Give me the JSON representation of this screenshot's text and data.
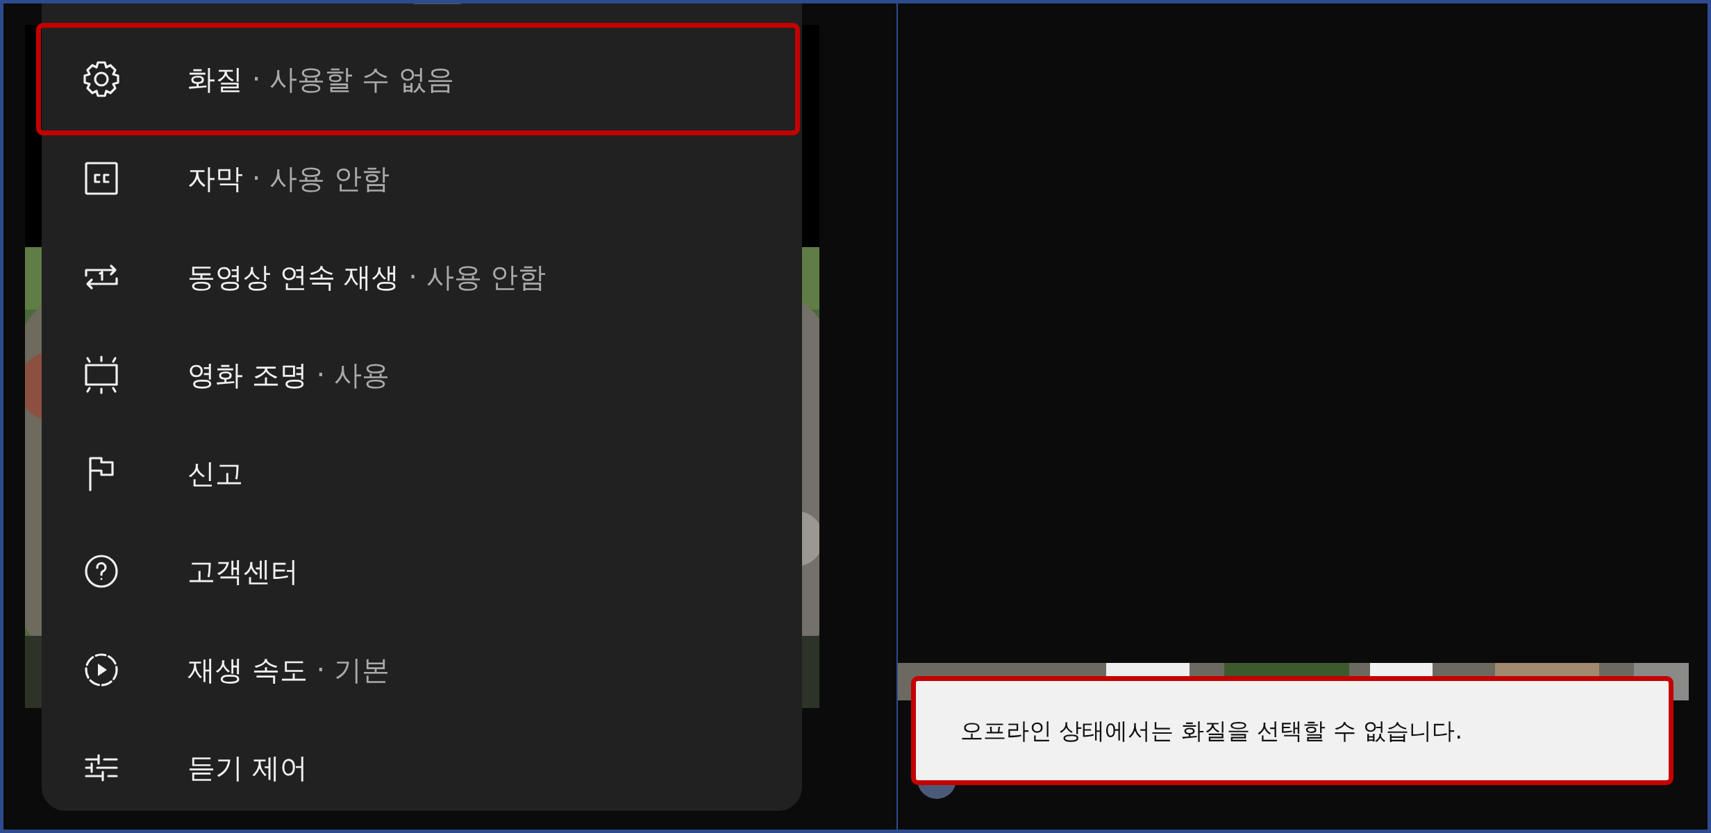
{
  "menu": {
    "items": [
      {
        "kind": "gear",
        "label": "화질",
        "detail": "· 사용할 수 없음",
        "highlighted": true
      },
      {
        "kind": "captions",
        "label": "자막",
        "detail": "· 사용 안함",
        "highlighted": false
      },
      {
        "kind": "repeat",
        "label": "동영상 연속 재생",
        "detail": "· 사용 안함",
        "highlighted": false
      },
      {
        "kind": "ambient",
        "label": "영화 조명",
        "detail": "· 사용",
        "highlighted": false
      },
      {
        "kind": "flag",
        "label": "신고",
        "highlighted": false
      },
      {
        "kind": "help",
        "label": "고객센터",
        "highlighted": false
      },
      {
        "kind": "speed",
        "label": "재생 속도",
        "detail": "· 기본",
        "highlighted": false
      },
      {
        "kind": "sliders",
        "label": "듣기 제어",
        "highlighted": false
      }
    ]
  },
  "toast": {
    "message": "오프라인 상태에서는 화질을 선택할 수 없습니다.",
    "highlighted": true
  }
}
